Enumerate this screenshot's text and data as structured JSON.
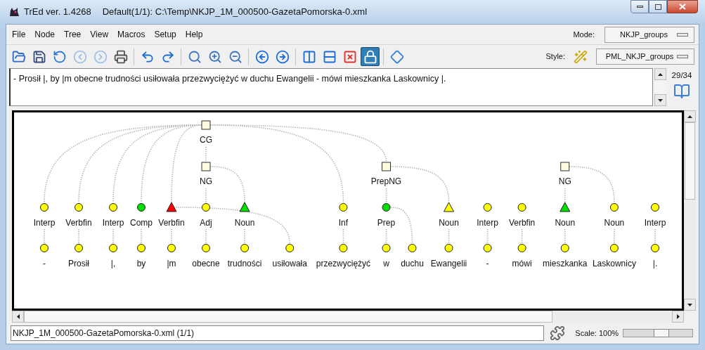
{
  "window": {
    "title": "TrEd ver. 1.4268",
    "document": "Default(1/1): C:\\Temp\\NKJP_1M_000500-GazetaPomorska-0.xml"
  },
  "menu": [
    "File",
    "Node",
    "Tree",
    "View",
    "Macros",
    "Setup",
    "Help"
  ],
  "mode": {
    "label": "Mode:",
    "value": "NKJP_groups"
  },
  "toolbar": [
    [
      {
        "kind": "open",
        "pressed": false,
        "disabled": false
      },
      {
        "kind": "save",
        "pressed": false,
        "disabled": false
      },
      {
        "kind": "goto",
        "pressed": false,
        "disabled": false
      },
      {
        "kind": "back",
        "pressed": false,
        "disabled": true
      },
      {
        "kind": "forward",
        "pressed": false,
        "disabled": true
      },
      {
        "kind": "print",
        "pressed": false,
        "disabled": false
      }
    ],
    [
      {
        "kind": "undo",
        "pressed": false,
        "disabled": false
      },
      {
        "kind": "redo",
        "pressed": false,
        "disabled": false
      }
    ],
    [
      {
        "kind": "find",
        "pressed": false,
        "disabled": false
      },
      {
        "kind": "find-next",
        "pressed": false,
        "disabled": false
      },
      {
        "kind": "find-prev",
        "pressed": false,
        "disabled": false
      }
    ],
    [
      {
        "kind": "prev-tree",
        "pressed": false,
        "disabled": false
      },
      {
        "kind": "next-tree",
        "pressed": false,
        "disabled": false
      }
    ],
    [
      {
        "kind": "split-vertical",
        "pressed": false,
        "disabled": false
      },
      {
        "kind": "split-horizontal",
        "pressed": false,
        "disabled": false
      },
      {
        "kind": "close-pane",
        "pressed": false,
        "disabled": false
      },
      {
        "kind": "lock",
        "pressed": true,
        "disabled": false
      }
    ],
    [
      {
        "kind": "diamond",
        "pressed": false,
        "disabled": false
      }
    ]
  ],
  "style": {
    "label": "Style:",
    "value": "PML_NKJP_groups"
  },
  "sentence": {
    "text": "- Prosił |, by |m obecne trudności usiłowała przezwyciężyć w duchu Ewangelii - mówi mieszkanka Laskownicy |.",
    "counter": "29/34"
  },
  "tree": [
    {
      "kind": "group",
      "label": "CG",
      "children": [
        {
          "kind": "tag",
          "label": "Interp",
          "triangle": false,
          "color": "#ffff00",
          "words": [
            "-"
          ]
        },
        {
          "kind": "tag",
          "label": "Verbfin",
          "triangle": false,
          "color": "#ffff00",
          "words": [
            "Prosił"
          ]
        },
        {
          "kind": "tag",
          "label": "Interp",
          "triangle": false,
          "color": "#ffff00",
          "words": [
            "|,"
          ]
        },
        {
          "kind": "tag",
          "label": "Comp",
          "triangle": false,
          "color": "#00dd00",
          "words": [
            "by"
          ]
        },
        {
          "kind": "tag",
          "label": "Verbfin",
          "triangle": true,
          "color": "#ff0000",
          "words": [
            "|m",
            "usiłowała"
          ]
        },
        {
          "kind": "group",
          "label": "NG",
          "children": [
            {
              "kind": "tag",
              "label": "Adj",
              "triangle": false,
              "color": "#ffff00",
              "words": [
                "obecne"
              ]
            },
            {
              "kind": "tag",
              "label": "Noun",
              "triangle": true,
              "color": "#00dd00",
              "words": [
                "trudności"
              ]
            }
          ]
        },
        {
          "kind": "tag",
          "label": "Inf",
          "triangle": false,
          "color": "#ffff00",
          "words": [
            "przezwyciężyć"
          ]
        },
        {
          "kind": "group",
          "label": "PrepNG",
          "children": [
            {
              "kind": "tag",
              "label": "Prep",
              "triangle": false,
              "color": "#00dd00",
              "words": [
                "w",
                "duchu"
              ]
            },
            {
              "kind": "tag",
              "label": "Noun",
              "triangle": true,
              "color": "#ffff00",
              "words": [
                "Ewangelii"
              ]
            }
          ]
        }
      ]
    },
    {
      "kind": "tag",
      "label": "Interp",
      "triangle": false,
      "color": "#ffff00",
      "words": [
        "-"
      ]
    },
    {
      "kind": "tag",
      "label": "Verbfin",
      "triangle": false,
      "color": "#ffff00",
      "words": [
        "mówi"
      ]
    },
    {
      "kind": "group",
      "label": "NG",
      "children": [
        {
          "kind": "tag",
          "label": "Noun",
          "triangle": true,
          "color": "#00dd00",
          "words": [
            "mieszkanka"
          ]
        },
        {
          "kind": "tag",
          "label": "Noun",
          "triangle": false,
          "color": "#ffff00",
          "words": [
            "Laskownicy"
          ]
        }
      ]
    },
    {
      "kind": "tag",
      "label": "Interp",
      "triangle": false,
      "color": "#ffff00",
      "words": [
        "|."
      ]
    }
  ],
  "status": {
    "file": "NKJP_1M_000500-GazetaPomorska-0.xml (1/1)",
    "scale": "Scale: 100%",
    "zoom_slider": {
      "level": 0.55
    }
  }
}
